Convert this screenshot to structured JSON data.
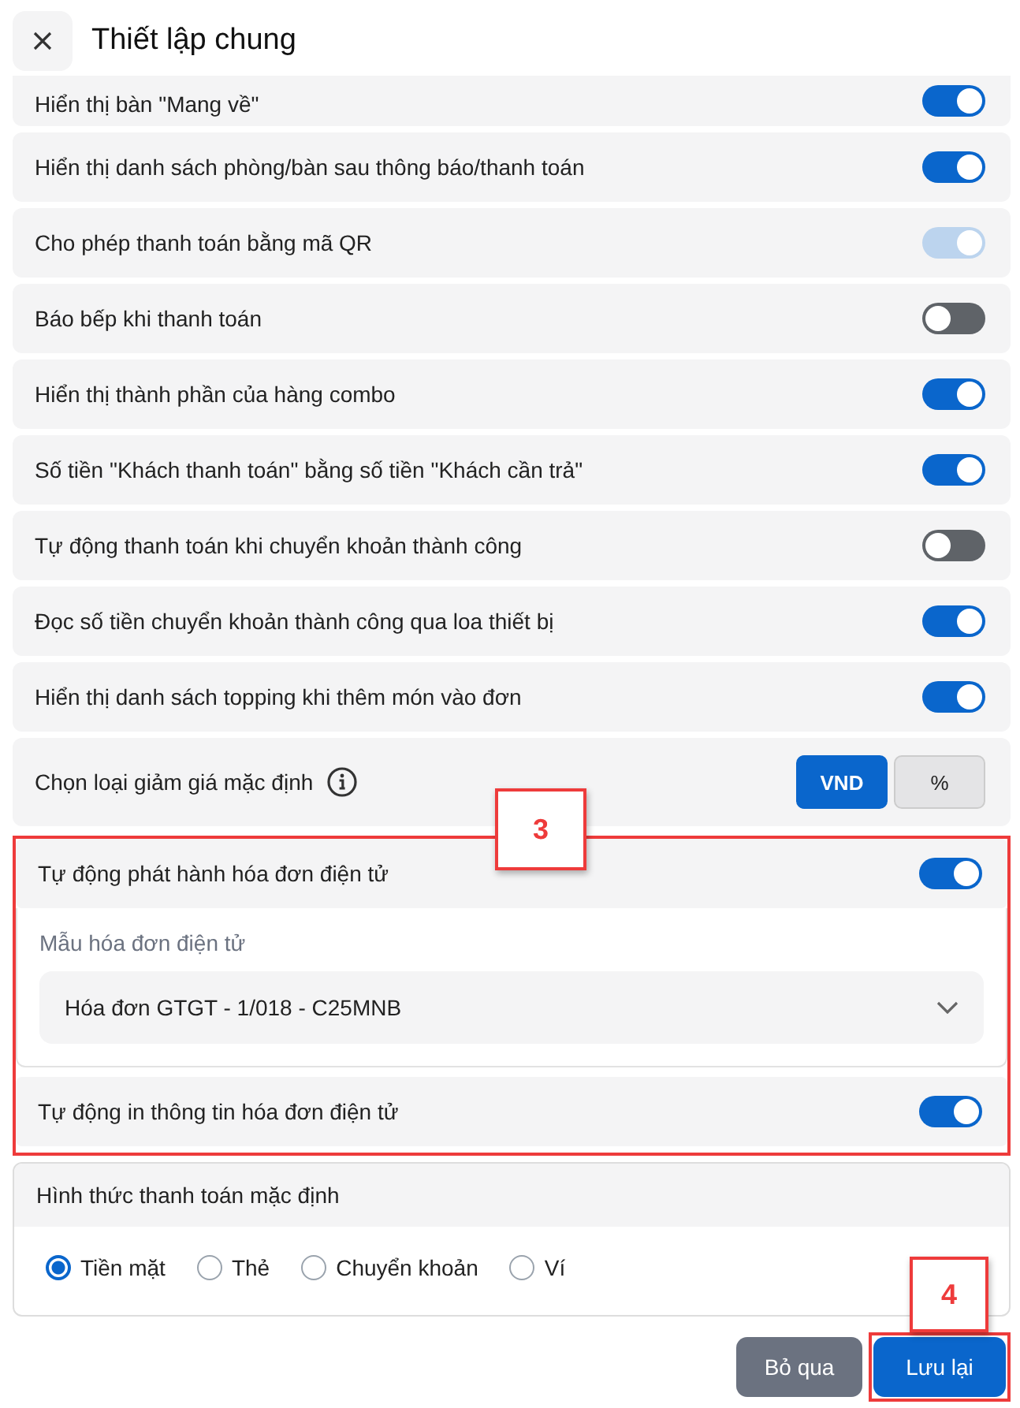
{
  "header": {
    "title": "Thiết lập chung"
  },
  "settings": [
    {
      "kind": "toggle",
      "label": "Hiển thị bàn \"Mang về\"",
      "on": true,
      "disabled": false,
      "clipped": true
    },
    {
      "kind": "toggle",
      "label": "Hiển thị danh sách phòng/bàn sau thông báo/thanh toán",
      "on": true,
      "disabled": false
    },
    {
      "kind": "toggle",
      "label": "Cho phép thanh toán bằng mã QR",
      "on": true,
      "disabled": true
    },
    {
      "kind": "toggle",
      "label": "Báo bếp khi thanh toán",
      "on": false,
      "disabled": false
    },
    {
      "kind": "toggle",
      "label": "Hiển thị thành phần của hàng combo",
      "on": true,
      "disabled": false
    },
    {
      "kind": "toggle",
      "label": "Số tiền \"Khách thanh toán\" bằng số tiền \"Khách cần trả\"",
      "on": true,
      "disabled": false
    },
    {
      "kind": "toggle",
      "label": "Tự động thanh toán khi chuyển khoản thành công",
      "on": false,
      "disabled": false
    },
    {
      "kind": "toggle",
      "label": "Đọc số tiền chuyển khoản thành công qua loa thiết bị",
      "on": true,
      "disabled": false
    },
    {
      "kind": "toggle",
      "label": "Hiển thị danh sách topping khi thêm món vào đơn",
      "on": true,
      "disabled": false
    },
    {
      "kind": "segmented",
      "label": "Chọn loại giảm giá mặc định",
      "info": true,
      "options": [
        {
          "label": "VND",
          "selected": true
        },
        {
          "label": "%",
          "selected": false
        }
      ]
    }
  ],
  "einvoice": {
    "callout": "3",
    "auto_issue": {
      "label": "Tự động phát hành hóa đơn điện tử",
      "on": true
    },
    "template_label": "Mẫu hóa đơn điện tử",
    "template_value": "Hóa đơn GTGT - 1/018 - C25MNB",
    "auto_print": {
      "label": "Tự động in thông tin hóa đơn điện tử",
      "on": true
    }
  },
  "payment": {
    "title": "Hình thức thanh toán mặc định",
    "options": [
      {
        "label": "Tiền mặt",
        "selected": true
      },
      {
        "label": "Thẻ",
        "selected": false
      },
      {
        "label": "Chuyển khoản",
        "selected": false
      },
      {
        "label": "Ví",
        "selected": false
      }
    ]
  },
  "buttons": [
    {
      "label": "Bỏ qua",
      "kind": "secondary"
    },
    {
      "label": "Lưu lại",
      "kind": "primary",
      "callout": "4"
    }
  ]
}
